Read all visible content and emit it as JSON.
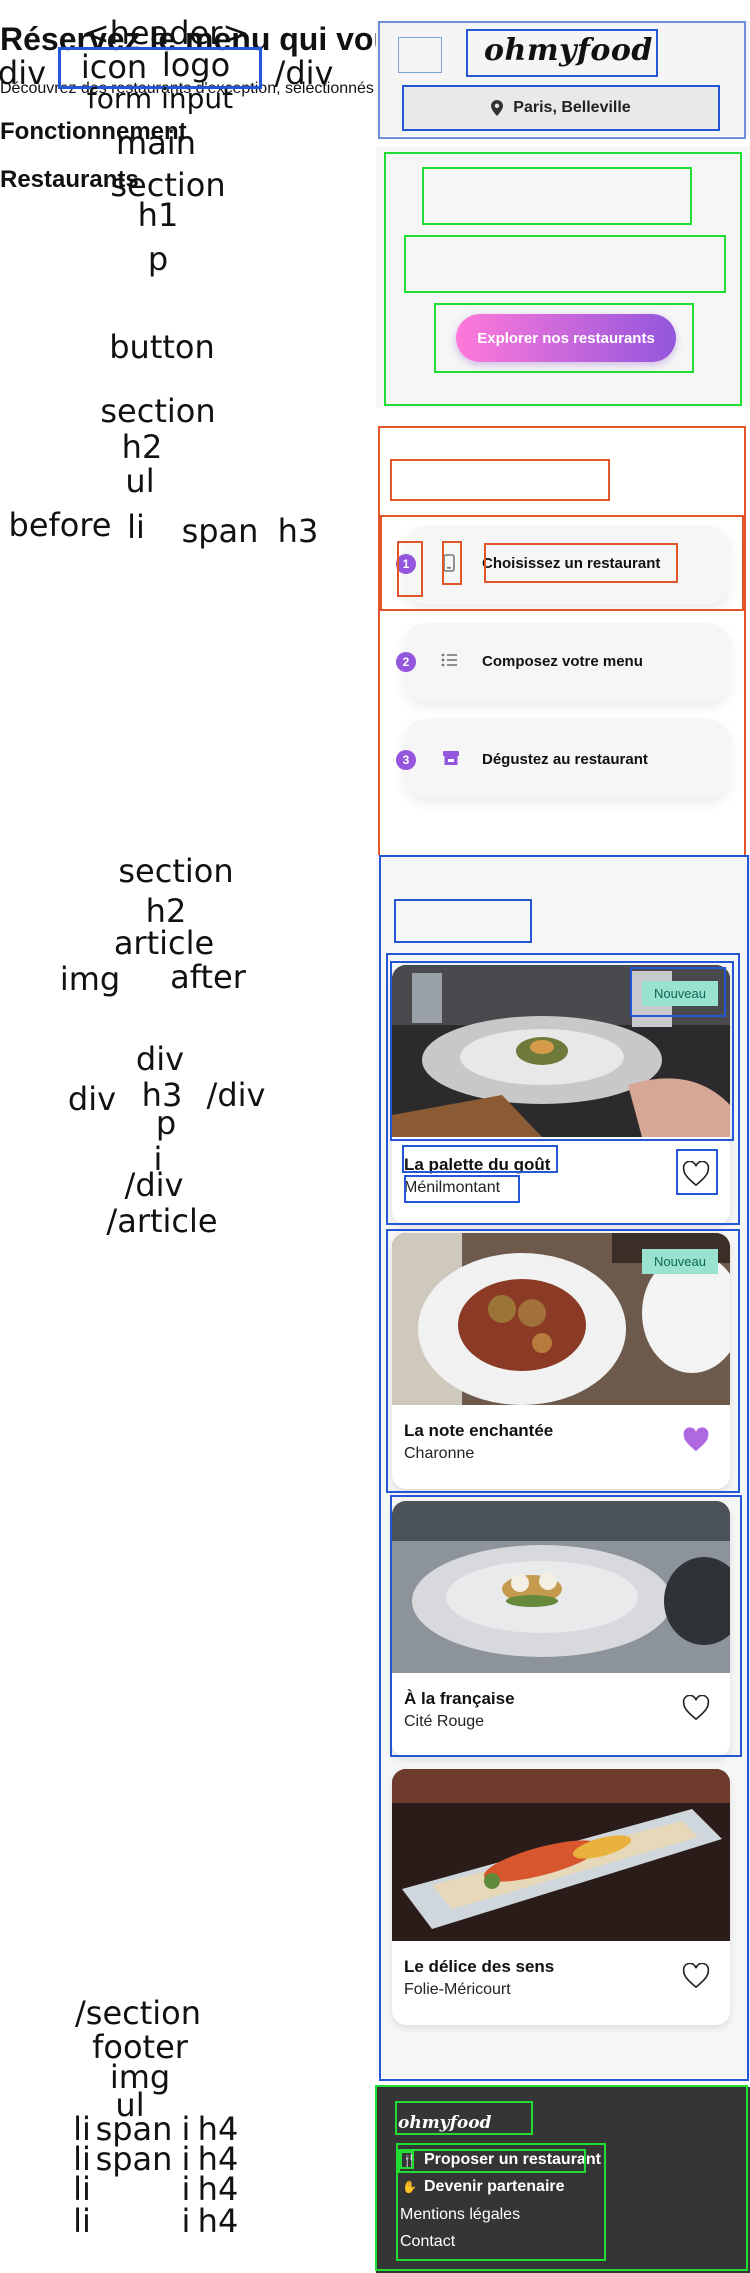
{
  "annotations": {
    "header": "<header>",
    "div_open": "div",
    "icon": "icon",
    "logo": "logo",
    "div_close": "/div",
    "form_input": "form input",
    "main": "main",
    "section1": "section",
    "h1": "h1",
    "p": "p",
    "button": "button",
    "section2": "section",
    "h2_a": "h2",
    "ul_a": "ul",
    "before": "before",
    "li_a": "li",
    "span_a": "span",
    "h3_a": "h3",
    "section3": "section",
    "h2_b": "h2",
    "article": "article",
    "img": "img",
    "after": "after",
    "div_b": "div",
    "div_c": "div",
    "h3_b": "h3",
    "div_close_b": "/div",
    "p_b": "p",
    "i_b": "i",
    "div_close_c": "/div",
    "article_close": "/article",
    "section_close": "/section",
    "footer": "footer",
    "img_f": "img",
    "ul_f": "ul",
    "li_1": "li",
    "span_1": "span",
    "i_1": "i",
    "h4_1": "h4",
    "li_2": "li",
    "span_2": "span",
    "i_2": "i",
    "h4_2": "h4",
    "li_3": "li",
    "i_3": "i",
    "h4_3": "h4",
    "li_4": "li",
    "i_4": "i",
    "h4_4": "h4"
  },
  "header": {
    "logo": "ohmyfood",
    "location": "Paris, Belleville",
    "location_icon": "map-pin-icon"
  },
  "hero": {
    "title": "Réservez le menu qui vous convient",
    "subtitle": "Découvrez des restaurants d'exception, sélectionnés par nos soins.",
    "cta": "Explorer nos restaurants"
  },
  "how": {
    "title": "Fonctionnement",
    "steps": [
      {
        "num": "1",
        "icon": "phone-icon",
        "label": "Choisissez un restaurant"
      },
      {
        "num": "2",
        "icon": "list-icon",
        "label": "Composez votre menu"
      },
      {
        "num": "3",
        "icon": "store-icon",
        "label": "Dégustez au restaurant"
      }
    ]
  },
  "restaurants": {
    "title": "Restaurants",
    "items": [
      {
        "name": "La palette du goût",
        "location": "Ménilmontant",
        "badge": "Nouveau",
        "liked": false
      },
      {
        "name": "La note enchantée",
        "location": "Charonne",
        "badge": "Nouveau",
        "liked": true
      },
      {
        "name": "À la française",
        "location": "Cité Rouge",
        "badge": "",
        "liked": false
      },
      {
        "name": "Le délice des sens",
        "location": "Folie-Méricourt",
        "badge": "",
        "liked": false
      }
    ]
  },
  "footer": {
    "logo": "ohmyfood",
    "links": [
      {
        "icon": "utensils-icon",
        "label": "Proposer un restaurant"
      },
      {
        "icon": "handshake-icon",
        "label": "Devenir partenaire"
      },
      {
        "icon": "",
        "label": "Mentions légales"
      },
      {
        "icon": "",
        "label": "Contact"
      }
    ]
  },
  "colors": {
    "accent": "#9356dc",
    "accent_pink": "#ff79da",
    "badge_bg": "#99e2d0",
    "footer_bg": "#353535",
    "box_blue": "#2457d6",
    "box_green": "#22dd33",
    "box_orange": "#e2542a"
  }
}
